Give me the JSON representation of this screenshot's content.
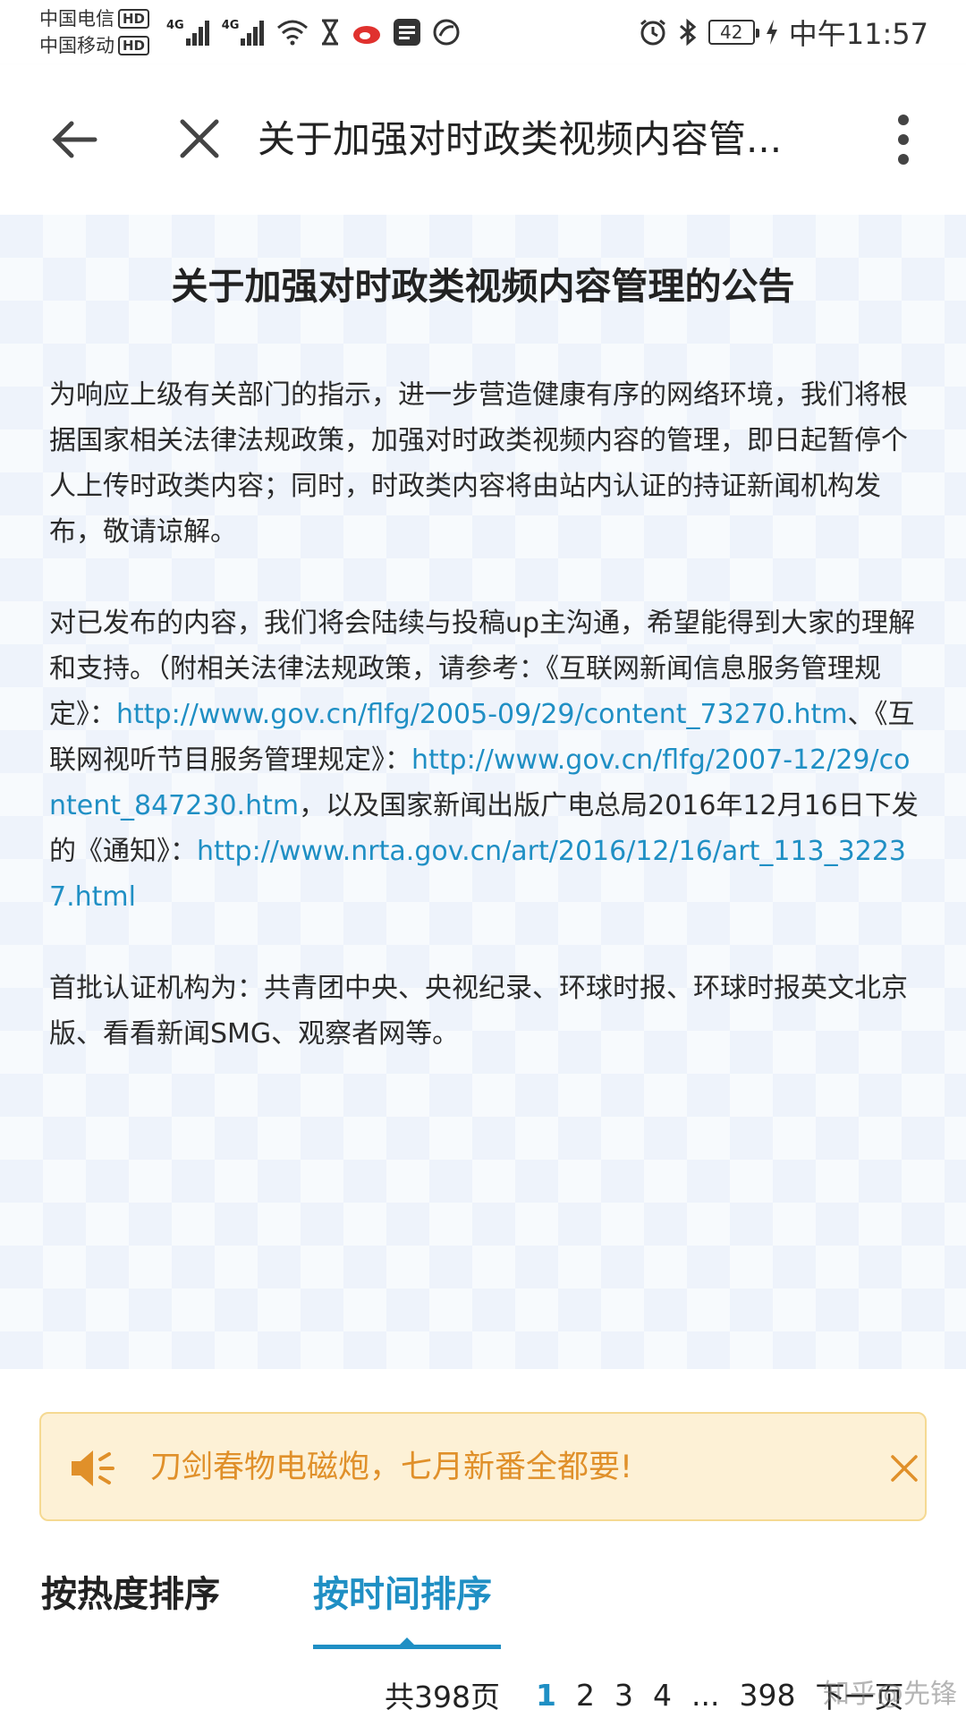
{
  "status_bar": {
    "carrier1": "中国电信",
    "carrier2": "中国移动",
    "hd": "HD",
    "net1": "4G",
    "net2": "4G",
    "battery": "42",
    "time": "中午11:57"
  },
  "nav": {
    "title": "关于加强对时政类视频内容管..."
  },
  "announcement": {
    "title": "关于加强对时政类视频内容管理的公告",
    "p1": "为响应上级有关部门的指示，进一步营造健康有序的网络环境，我们将根据国家相关法律法规政策，加强对时政类视频内容的管理，即日起暂停个人上传时政类内容；同时，时政类内容将由站内认证的持证新闻机构发布，敬请谅解。",
    "p2_a": "对已发布的内容，我们将会陆续与投稿up主沟通，希望能得到大家的理解和支持。（附相关法律法规政策，请参考：《互联网新闻信息服务管理规定》：",
    "p2_link1": "http://www.gov.cn/flfg/2005-09/29/content_73270.htm",
    "p2_b": "、《互联网视听节目服务管理规定》：",
    "p2_link2": "http://www.gov.cn/flfg/2007-12/29/content_847230.htm",
    "p2_c": "，以及国家新闻出版广电总局2016年12月16日下发的《通知》：",
    "p2_link3": "http://www.nrta.gov.cn/art/2016/12/16/art_113_32237.html",
    "p3": "首批认证机构为：共青团中央、央视纪录、环球时报、环球时报英文北京版、看看新闻SMG、观察者网等。"
  },
  "notice": {
    "text": "刀剑春物电磁炮，七月新番全都要!"
  },
  "tabs": {
    "hot": "按热度排序",
    "time": "按时间排序"
  },
  "pagination": {
    "total": "共398页",
    "p1": "1",
    "p2": "2",
    "p3": "3",
    "p4": "4",
    "ellipsis": "...",
    "last": "398",
    "next": "下一页"
  },
  "watermark": "知乎@先锋",
  "colors": {
    "accent": "#1f8fc4",
    "notice_text": "#e0902a",
    "notice_bg": "#fdf1d6"
  }
}
